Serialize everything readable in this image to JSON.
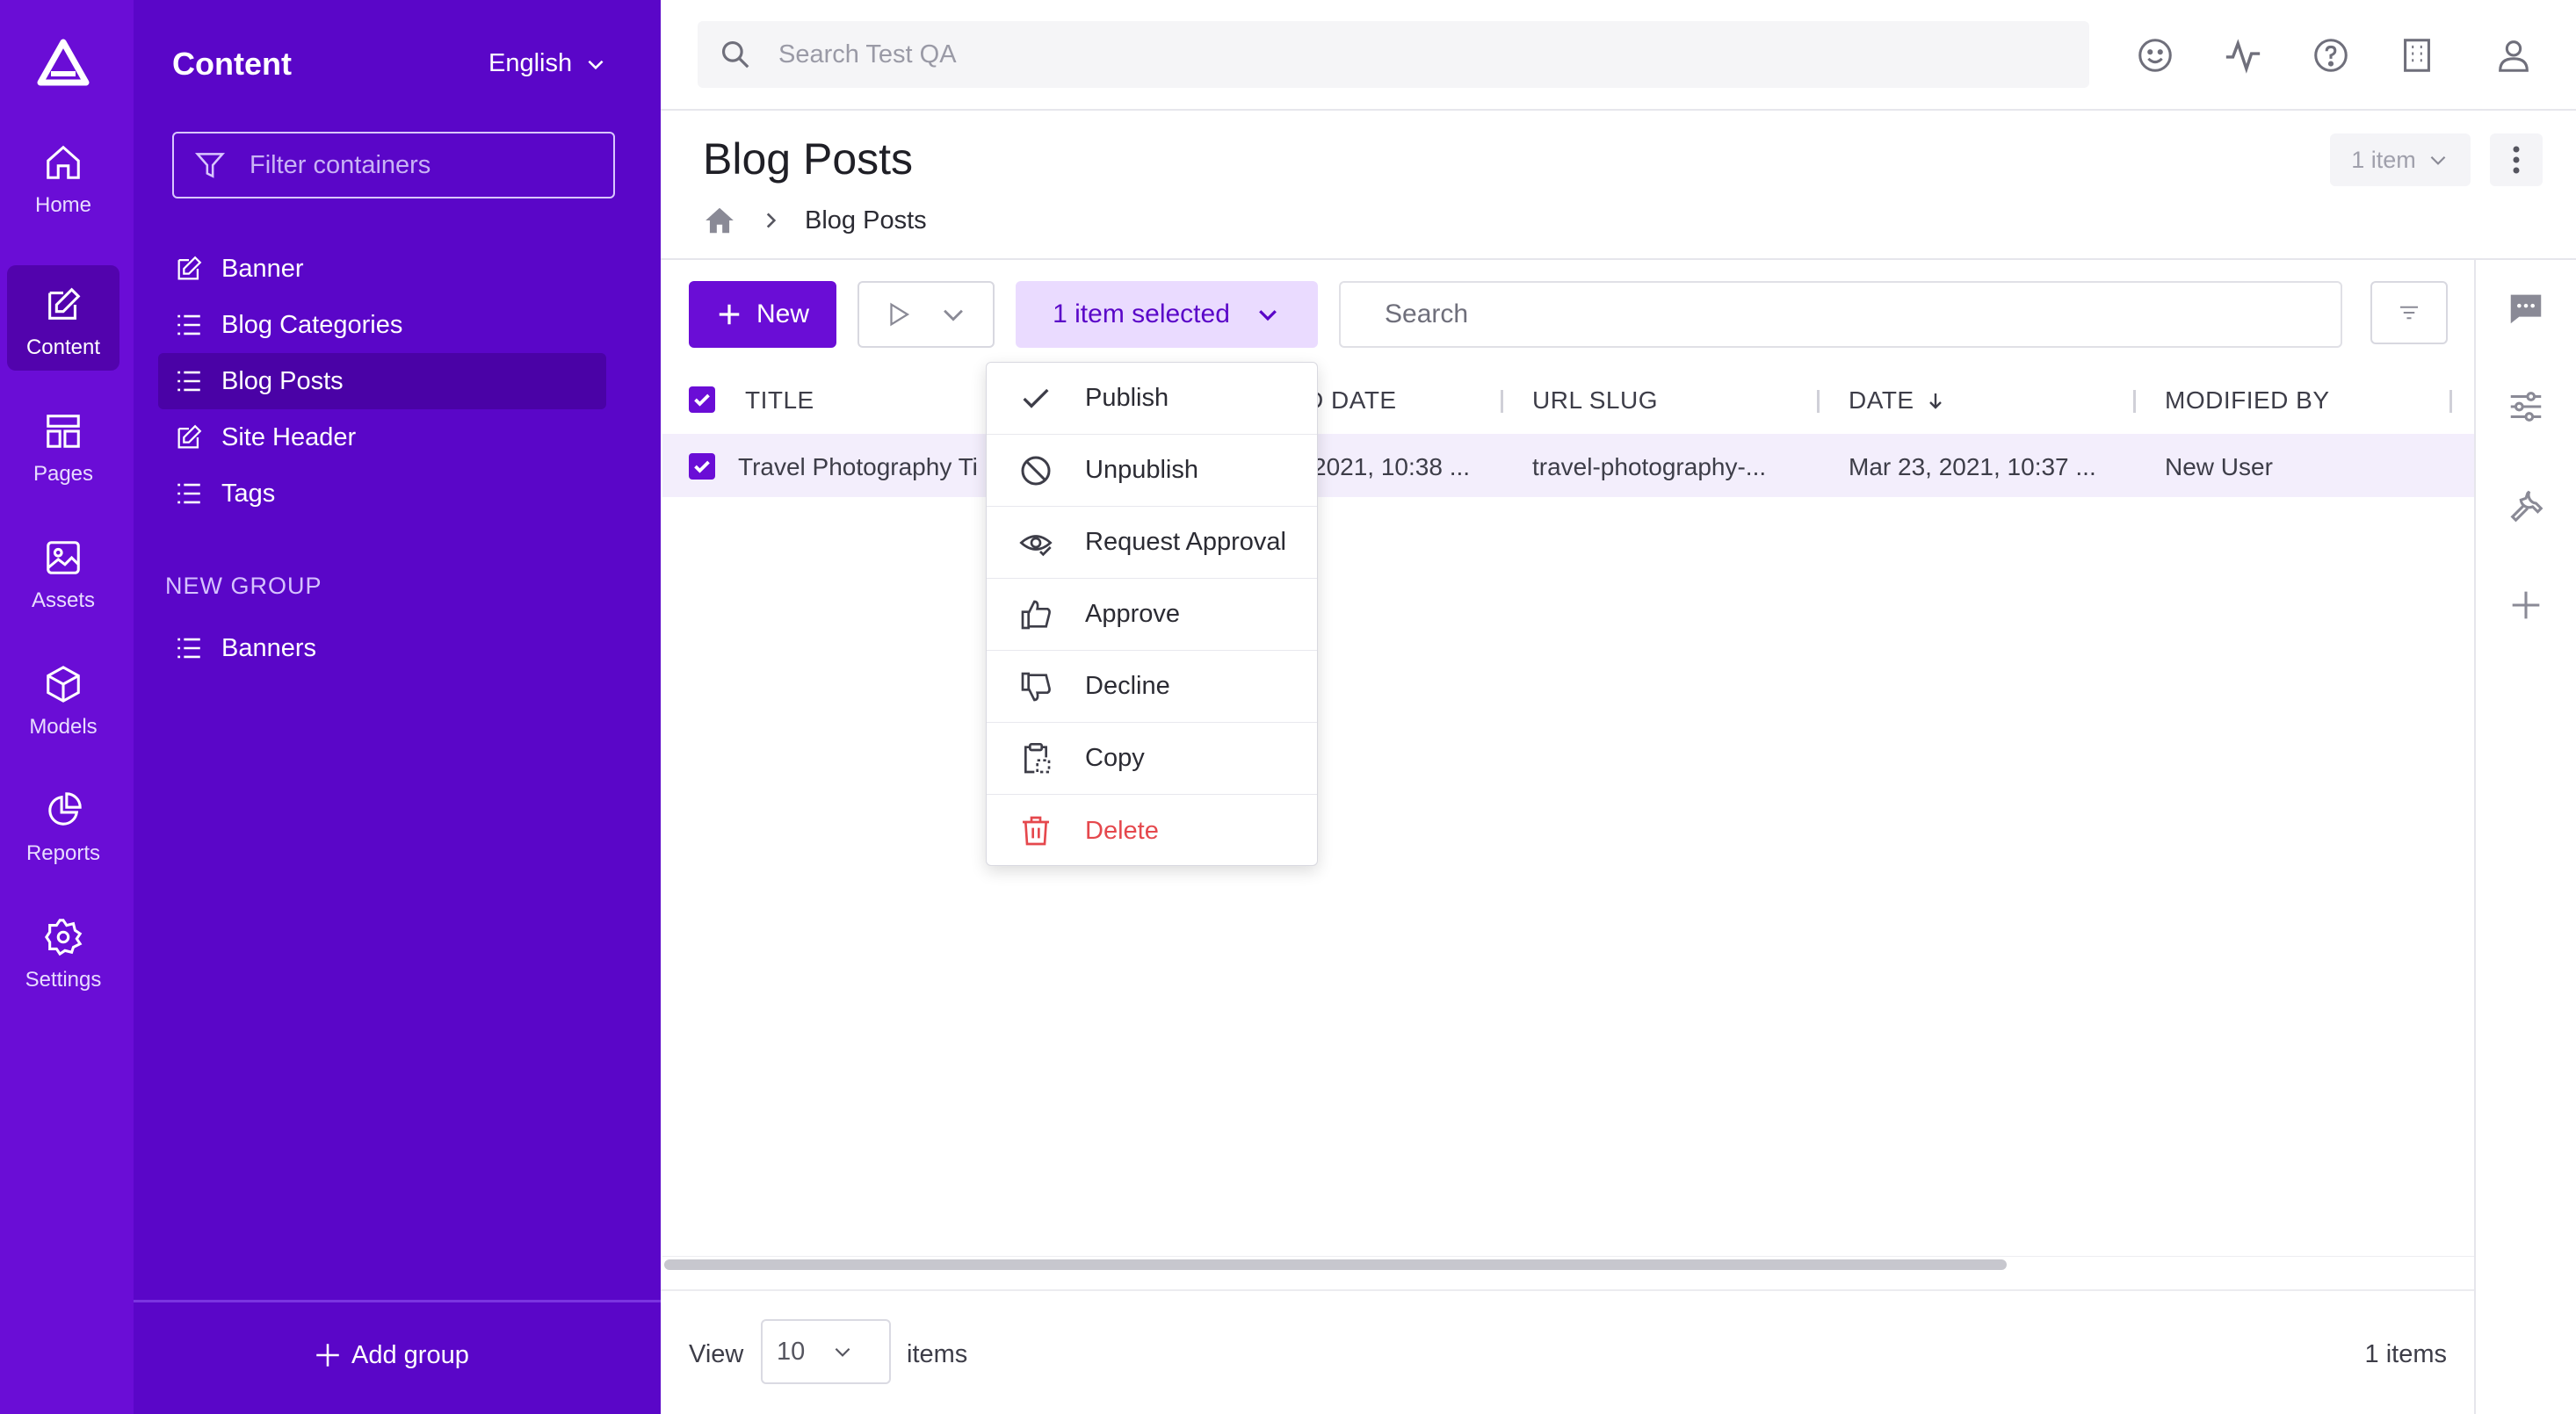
{
  "rail": {
    "items": [
      {
        "label": "Home",
        "icon": "home-icon"
      },
      {
        "label": "Content",
        "icon": "edit-icon",
        "active": true
      },
      {
        "label": "Pages",
        "icon": "layout-icon"
      },
      {
        "label": "Assets",
        "icon": "image-icon"
      },
      {
        "label": "Models",
        "icon": "cube-icon"
      },
      {
        "label": "Reports",
        "icon": "pie-chart-icon"
      },
      {
        "label": "Settings",
        "icon": "gear-icon"
      }
    ]
  },
  "panel": {
    "title": "Content",
    "language": "English",
    "filter_placeholder": "Filter containers",
    "items": [
      {
        "label": "Banner",
        "icon": "edit-icon"
      },
      {
        "label": "Blog Categories",
        "icon": "list-icon"
      },
      {
        "label": "Blog Posts",
        "icon": "list-icon",
        "active": true
      },
      {
        "label": "Site Header",
        "icon": "edit-icon"
      },
      {
        "label": "Tags",
        "icon": "list-icon"
      }
    ],
    "group_title": "NEW GROUP",
    "group_items": [
      {
        "label": "Banners",
        "icon": "list-icon"
      }
    ],
    "add_group": "Add group"
  },
  "topbar": {
    "search_placeholder": "Search Test QA"
  },
  "header": {
    "title": "Blog Posts",
    "breadcrumb_current": "Blog Posts",
    "items_chip": "1 item"
  },
  "toolbar": {
    "new_label": "New",
    "selected_label": "1 item selected",
    "search_placeholder": "Search"
  },
  "table": {
    "columns": [
      "TITLE",
      "D DATE",
      "URL SLUG",
      "DATE",
      "MODIFIED BY"
    ],
    "rows": [
      {
        "title": "Travel Photography Ti",
        "d_date": "2021, 10:38 ...",
        "slug": "travel-photography-...",
        "date": "Mar 23, 2021, 10:37 ...",
        "modified_by": "New User"
      }
    ]
  },
  "menu": {
    "items": [
      {
        "label": "Publish",
        "icon": "check-icon"
      },
      {
        "label": "Unpublish",
        "icon": "ban-icon"
      },
      {
        "label": "Request Approval",
        "icon": "eye-check-icon"
      },
      {
        "label": "Approve",
        "icon": "thumbs-up-icon"
      },
      {
        "label": "Decline",
        "icon": "thumbs-down-icon"
      },
      {
        "label": "Copy",
        "icon": "clipboard-copy-icon"
      },
      {
        "label": "Delete",
        "icon": "trash-icon",
        "danger": true
      }
    ]
  },
  "footer": {
    "view_label": "View",
    "page_size": "10",
    "items_label": "items",
    "count": "1 items"
  },
  "colors": {
    "rail": "#6a0dd6",
    "panel": "#5a06c8",
    "accent": "#6a0dd6",
    "danger": "#e5484d",
    "selected_row": "#f3eefc"
  }
}
